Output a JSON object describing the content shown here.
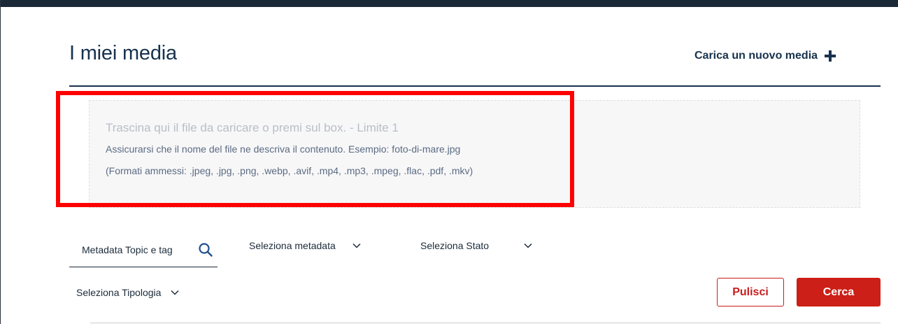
{
  "header": {
    "title": "I miei media",
    "upload_label": "Carica un nuovo media",
    "upload_icon": "plus-icon"
  },
  "dropzone": {
    "main_text": "Trascina qui il file da caricare o premi sul box. - Limite 1",
    "hint_text": "Assicurarsi che il nome del file ne descriva il contenuto. Esempio: foto-di-mare.jpg",
    "formats_text": "(Formati ammessi: .jpeg, .jpg, .png, .webp, .avif, .mp4, .mp3, .mpeg, .flac, .pdf, .mkv)"
  },
  "filters": {
    "search_value": "Metadata Topic e tag",
    "search_icon": "search-icon",
    "metadata_select": "Seleziona metadata",
    "stato_select": "Seleziona Stato",
    "tipologia_select": "Seleziona Tipologia",
    "chevron_icon": "chevron-down-icon"
  },
  "actions": {
    "clear_label": "Pulisci",
    "search_label": "Cerca"
  },
  "colors": {
    "primary_text": "#17324d",
    "accent_red": "#cc1f17",
    "highlight": "#ff0000"
  }
}
